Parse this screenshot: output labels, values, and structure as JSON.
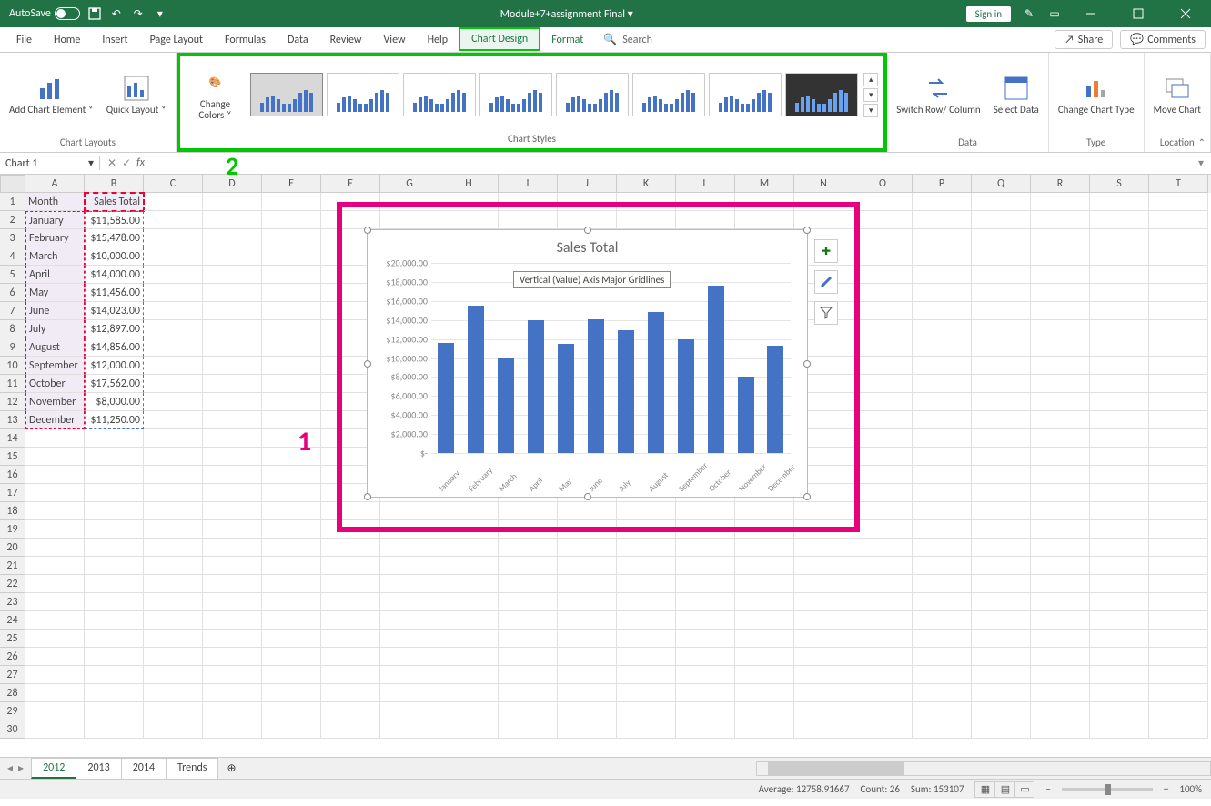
{
  "title_bar": {
    "autosave_label": "AutoSave",
    "autosave_state": "Off",
    "document_title": "Module+7+assignment Final ▾",
    "signin": "Sign in"
  },
  "tabs": {
    "file": "File",
    "home": "Home",
    "insert": "Insert",
    "page_layout": "Page Layout",
    "formulas": "Formulas",
    "data": "Data",
    "review": "Review",
    "view": "View",
    "help": "Help",
    "chart_design": "Chart Design",
    "format": "Format",
    "search": "Search",
    "share": "Share",
    "comments": "Comments"
  },
  "ribbon": {
    "add_chart_element": "Add Chart Element ˅",
    "quick_layout": "Quick Layout ˅",
    "change_colors": "Change Colors ˅",
    "chart_layouts": "Chart Layouts",
    "chart_styles": "Chart Styles",
    "switch_row_col": "Switch Row/ Column",
    "select_data": "Select Data",
    "data": "Data",
    "change_chart_type": "Change Chart Type",
    "type": "Type",
    "move_chart": "Move Chart",
    "location": "Location"
  },
  "namebox": "Chart 1",
  "columns": [
    "A",
    "B",
    "C",
    "D",
    "E",
    "F",
    "G",
    "H",
    "I",
    "J",
    "K",
    "L",
    "M",
    "N",
    "O",
    "P",
    "Q",
    "R",
    "S",
    "T"
  ],
  "header_row": {
    "A": "Month",
    "B": "Sales Total"
  },
  "rows": [
    {
      "A": "January",
      "B": "$11,585.00"
    },
    {
      "A": "February",
      "B": "$15,478.00"
    },
    {
      "A": "March",
      "B": "$10,000.00"
    },
    {
      "A": "April",
      "B": "$14,000.00"
    },
    {
      "A": "May",
      "B": "$11,456.00"
    },
    {
      "A": "June",
      "B": "$14,023.00"
    },
    {
      "A": "July",
      "B": "$12,897.00"
    },
    {
      "A": "August",
      "B": "$14,856.00"
    },
    {
      "A": "September",
      "B": "$12,000.00"
    },
    {
      "A": "October",
      "B": "$17,562.00"
    },
    {
      "A": "November",
      "B": "$8,000.00"
    },
    {
      "A": "December",
      "B": "$11,250.00"
    }
  ],
  "chart_data": {
    "type": "bar",
    "title": "Sales Total",
    "categories": [
      "January",
      "February",
      "March",
      "April",
      "May",
      "June",
      "July",
      "August",
      "September",
      "October",
      "November",
      "December"
    ],
    "values": [
      11585,
      15478,
      10000,
      14000,
      11456,
      14023,
      12897,
      14856,
      12000,
      17562,
      8000,
      11250
    ],
    "ylabel": "",
    "xlabel": "",
    "ylim": [
      0,
      20000
    ],
    "y_ticks": [
      "$-",
      "$2,000.00",
      "$4,000.00",
      "$6,000.00",
      "$8,000.00",
      "$10,000.00",
      "$12,000.00",
      "$14,000.00",
      "$16,000.00",
      "$18,000.00",
      "$20,000.00"
    ],
    "tooltip": "Vertical (Value) Axis Major Gridlines"
  },
  "sheet_tabs": [
    "2012",
    "2013",
    "2014",
    "Trends"
  ],
  "status": {
    "average": "Average: 12758.91667",
    "count": "Count: 26",
    "sum": "Sum: 153107",
    "zoom": "100%"
  },
  "annotations": {
    "one": "1",
    "two": "2"
  }
}
